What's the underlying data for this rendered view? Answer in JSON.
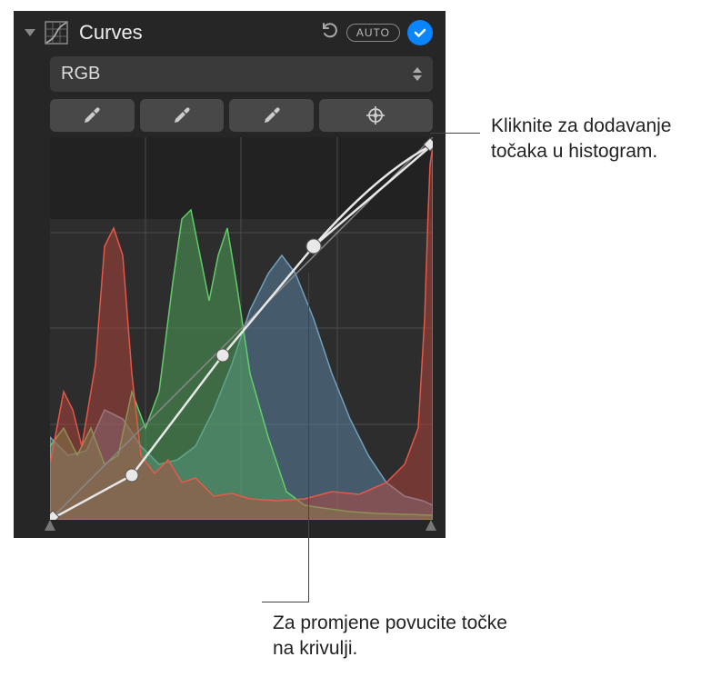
{
  "header": {
    "title": "Curves",
    "auto_label": "AUTO"
  },
  "channel": {
    "selected": "RGB"
  },
  "callouts": {
    "add_points": "Kliknite za dodavanje točaka u histogram.",
    "drag_points": "Za promjene povucite točke na krivulji."
  }
}
